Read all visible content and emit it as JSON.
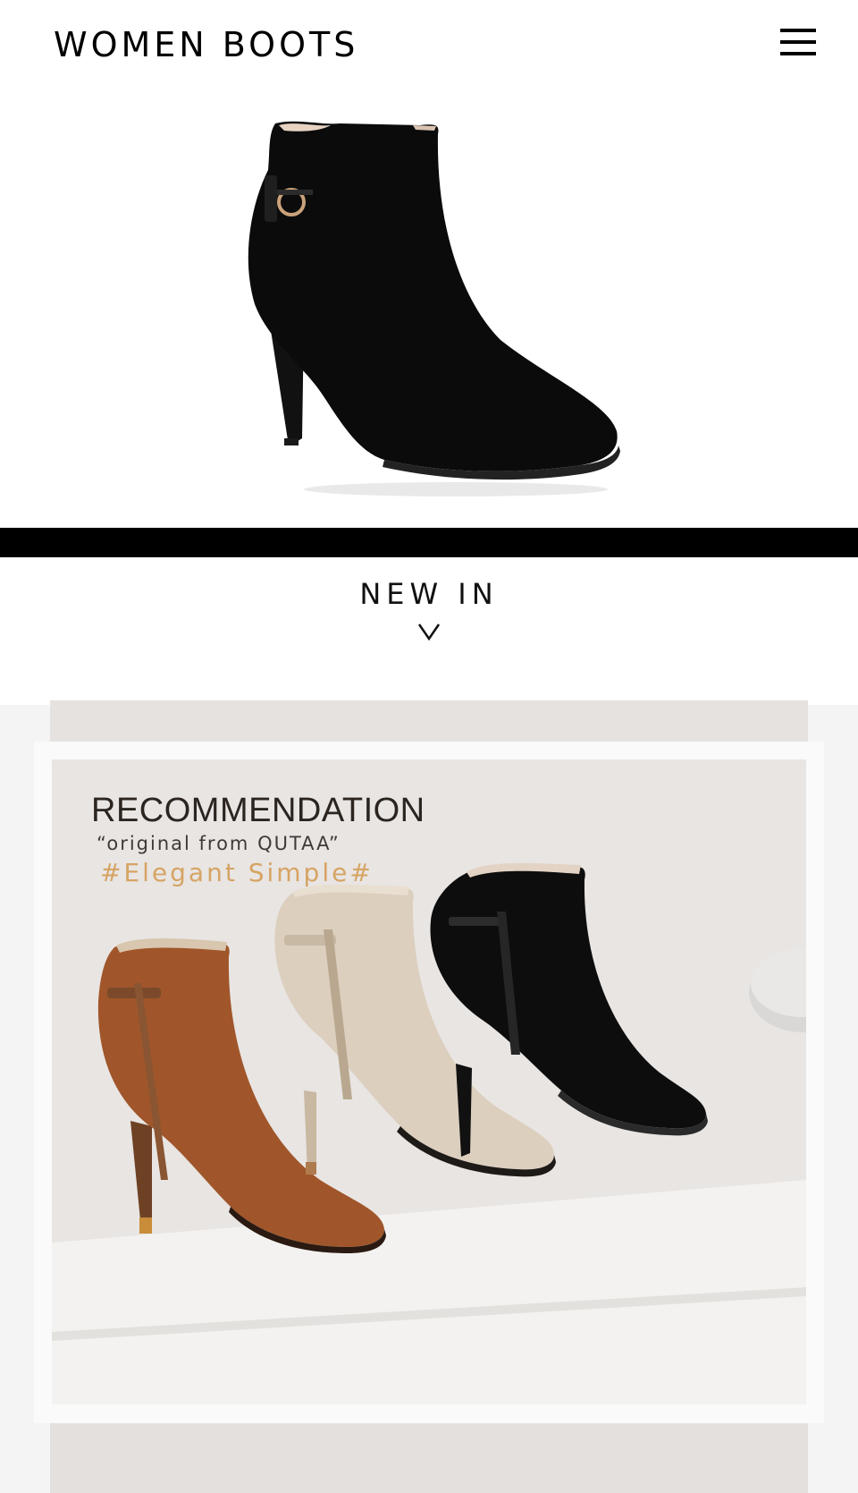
{
  "header": {
    "title": "WOMEN BOOTS",
    "menu_icon": "hamburger-menu-icon"
  },
  "hero": {
    "image": "black-suede-ankle-boot"
  },
  "section": {
    "heading": "NEW IN",
    "chevron_icon": "chevron-down-icon"
  },
  "recommendation": {
    "title": "RECOMMENDATION",
    "subtitle": "“original from QUTAA”",
    "tag": "#Elegant Simple#",
    "tag_color": "#d6a464"
  },
  "colors": {
    "band": "#000000",
    "panel": "#f4f4f4"
  }
}
